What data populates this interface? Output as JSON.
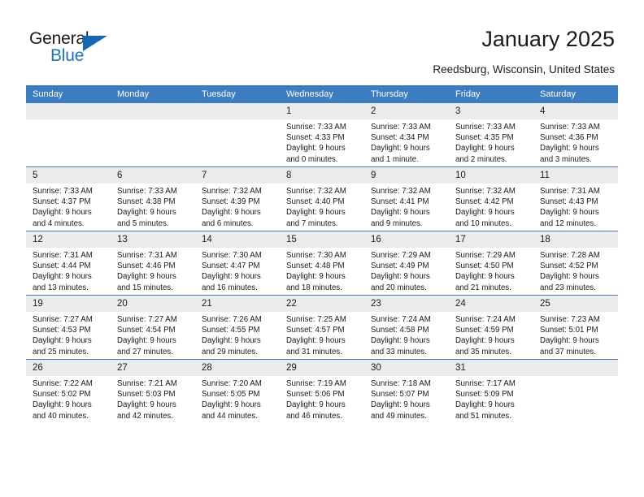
{
  "brand": {
    "name_top": "General",
    "name_bottom": "Blue",
    "color_blue": "#1773c4",
    "triangle_color": "#1268b3"
  },
  "header": {
    "title": "January 2025",
    "subtitle": "Reedsburg, Wisconsin, United States"
  },
  "theme": {
    "header_row_bg": "#3b7dc0",
    "daynum_bg": "#ebebeb",
    "text_color": "#1b1b1b"
  },
  "weekdays": [
    "Sunday",
    "Monday",
    "Tuesday",
    "Wednesday",
    "Thursday",
    "Friday",
    "Saturday"
  ],
  "labels": {
    "sunrise_prefix": "Sunrise:",
    "sunset_prefix": "Sunset:",
    "daylight_prefix": "Daylight:"
  },
  "weeks": [
    [
      {
        "day": "",
        "blank": true
      },
      {
        "day": "",
        "blank": true
      },
      {
        "day": "",
        "blank": true
      },
      {
        "day": "1",
        "sunrise": "Sunrise: 7:33 AM",
        "sunset": "Sunset: 4:33 PM",
        "daylight_line1": "Daylight: 9 hours",
        "daylight_line2": "and 0 minutes."
      },
      {
        "day": "2",
        "sunrise": "Sunrise: 7:33 AM",
        "sunset": "Sunset: 4:34 PM",
        "daylight_line1": "Daylight: 9 hours",
        "daylight_line2": "and 1 minute."
      },
      {
        "day": "3",
        "sunrise": "Sunrise: 7:33 AM",
        "sunset": "Sunset: 4:35 PM",
        "daylight_line1": "Daylight: 9 hours",
        "daylight_line2": "and 2 minutes."
      },
      {
        "day": "4",
        "sunrise": "Sunrise: 7:33 AM",
        "sunset": "Sunset: 4:36 PM",
        "daylight_line1": "Daylight: 9 hours",
        "daylight_line2": "and 3 minutes."
      }
    ],
    [
      {
        "day": "5",
        "sunrise": "Sunrise: 7:33 AM",
        "sunset": "Sunset: 4:37 PM",
        "daylight_line1": "Daylight: 9 hours",
        "daylight_line2": "and 4 minutes."
      },
      {
        "day": "6",
        "sunrise": "Sunrise: 7:33 AM",
        "sunset": "Sunset: 4:38 PM",
        "daylight_line1": "Daylight: 9 hours",
        "daylight_line2": "and 5 minutes."
      },
      {
        "day": "7",
        "sunrise": "Sunrise: 7:32 AM",
        "sunset": "Sunset: 4:39 PM",
        "daylight_line1": "Daylight: 9 hours",
        "daylight_line2": "and 6 minutes."
      },
      {
        "day": "8",
        "sunrise": "Sunrise: 7:32 AM",
        "sunset": "Sunset: 4:40 PM",
        "daylight_line1": "Daylight: 9 hours",
        "daylight_line2": "and 7 minutes."
      },
      {
        "day": "9",
        "sunrise": "Sunrise: 7:32 AM",
        "sunset": "Sunset: 4:41 PM",
        "daylight_line1": "Daylight: 9 hours",
        "daylight_line2": "and 9 minutes."
      },
      {
        "day": "10",
        "sunrise": "Sunrise: 7:32 AM",
        "sunset": "Sunset: 4:42 PM",
        "daylight_line1": "Daylight: 9 hours",
        "daylight_line2": "and 10 minutes."
      },
      {
        "day": "11",
        "sunrise": "Sunrise: 7:31 AM",
        "sunset": "Sunset: 4:43 PM",
        "daylight_line1": "Daylight: 9 hours",
        "daylight_line2": "and 12 minutes."
      }
    ],
    [
      {
        "day": "12",
        "sunrise": "Sunrise: 7:31 AM",
        "sunset": "Sunset: 4:44 PM",
        "daylight_line1": "Daylight: 9 hours",
        "daylight_line2": "and 13 minutes."
      },
      {
        "day": "13",
        "sunrise": "Sunrise: 7:31 AM",
        "sunset": "Sunset: 4:46 PM",
        "daylight_line1": "Daylight: 9 hours",
        "daylight_line2": "and 15 minutes."
      },
      {
        "day": "14",
        "sunrise": "Sunrise: 7:30 AM",
        "sunset": "Sunset: 4:47 PM",
        "daylight_line1": "Daylight: 9 hours",
        "daylight_line2": "and 16 minutes."
      },
      {
        "day": "15",
        "sunrise": "Sunrise: 7:30 AM",
        "sunset": "Sunset: 4:48 PM",
        "daylight_line1": "Daylight: 9 hours",
        "daylight_line2": "and 18 minutes."
      },
      {
        "day": "16",
        "sunrise": "Sunrise: 7:29 AM",
        "sunset": "Sunset: 4:49 PM",
        "daylight_line1": "Daylight: 9 hours",
        "daylight_line2": "and 20 minutes."
      },
      {
        "day": "17",
        "sunrise": "Sunrise: 7:29 AM",
        "sunset": "Sunset: 4:50 PM",
        "daylight_line1": "Daylight: 9 hours",
        "daylight_line2": "and 21 minutes."
      },
      {
        "day": "18",
        "sunrise": "Sunrise: 7:28 AM",
        "sunset": "Sunset: 4:52 PM",
        "daylight_line1": "Daylight: 9 hours",
        "daylight_line2": "and 23 minutes."
      }
    ],
    [
      {
        "day": "19",
        "sunrise": "Sunrise: 7:27 AM",
        "sunset": "Sunset: 4:53 PM",
        "daylight_line1": "Daylight: 9 hours",
        "daylight_line2": "and 25 minutes."
      },
      {
        "day": "20",
        "sunrise": "Sunrise: 7:27 AM",
        "sunset": "Sunset: 4:54 PM",
        "daylight_line1": "Daylight: 9 hours",
        "daylight_line2": "and 27 minutes."
      },
      {
        "day": "21",
        "sunrise": "Sunrise: 7:26 AM",
        "sunset": "Sunset: 4:55 PM",
        "daylight_line1": "Daylight: 9 hours",
        "daylight_line2": "and 29 minutes."
      },
      {
        "day": "22",
        "sunrise": "Sunrise: 7:25 AM",
        "sunset": "Sunset: 4:57 PM",
        "daylight_line1": "Daylight: 9 hours",
        "daylight_line2": "and 31 minutes."
      },
      {
        "day": "23",
        "sunrise": "Sunrise: 7:24 AM",
        "sunset": "Sunset: 4:58 PM",
        "daylight_line1": "Daylight: 9 hours",
        "daylight_line2": "and 33 minutes."
      },
      {
        "day": "24",
        "sunrise": "Sunrise: 7:24 AM",
        "sunset": "Sunset: 4:59 PM",
        "daylight_line1": "Daylight: 9 hours",
        "daylight_line2": "and 35 minutes."
      },
      {
        "day": "25",
        "sunrise": "Sunrise: 7:23 AM",
        "sunset": "Sunset: 5:01 PM",
        "daylight_line1": "Daylight: 9 hours",
        "daylight_line2": "and 37 minutes."
      }
    ],
    [
      {
        "day": "26",
        "sunrise": "Sunrise: 7:22 AM",
        "sunset": "Sunset: 5:02 PM",
        "daylight_line1": "Daylight: 9 hours",
        "daylight_line2": "and 40 minutes."
      },
      {
        "day": "27",
        "sunrise": "Sunrise: 7:21 AM",
        "sunset": "Sunset: 5:03 PM",
        "daylight_line1": "Daylight: 9 hours",
        "daylight_line2": "and 42 minutes."
      },
      {
        "day": "28",
        "sunrise": "Sunrise: 7:20 AM",
        "sunset": "Sunset: 5:05 PM",
        "daylight_line1": "Daylight: 9 hours",
        "daylight_line2": "and 44 minutes."
      },
      {
        "day": "29",
        "sunrise": "Sunrise: 7:19 AM",
        "sunset": "Sunset: 5:06 PM",
        "daylight_line1": "Daylight: 9 hours",
        "daylight_line2": "and 46 minutes."
      },
      {
        "day": "30",
        "sunrise": "Sunrise: 7:18 AM",
        "sunset": "Sunset: 5:07 PM",
        "daylight_line1": "Daylight: 9 hours",
        "daylight_line2": "and 49 minutes."
      },
      {
        "day": "31",
        "sunrise": "Sunrise: 7:17 AM",
        "sunset": "Sunset: 5:09 PM",
        "daylight_line1": "Daylight: 9 hours",
        "daylight_line2": "and 51 minutes."
      },
      {
        "day": "",
        "blank": true,
        "trailing": true
      }
    ]
  ]
}
